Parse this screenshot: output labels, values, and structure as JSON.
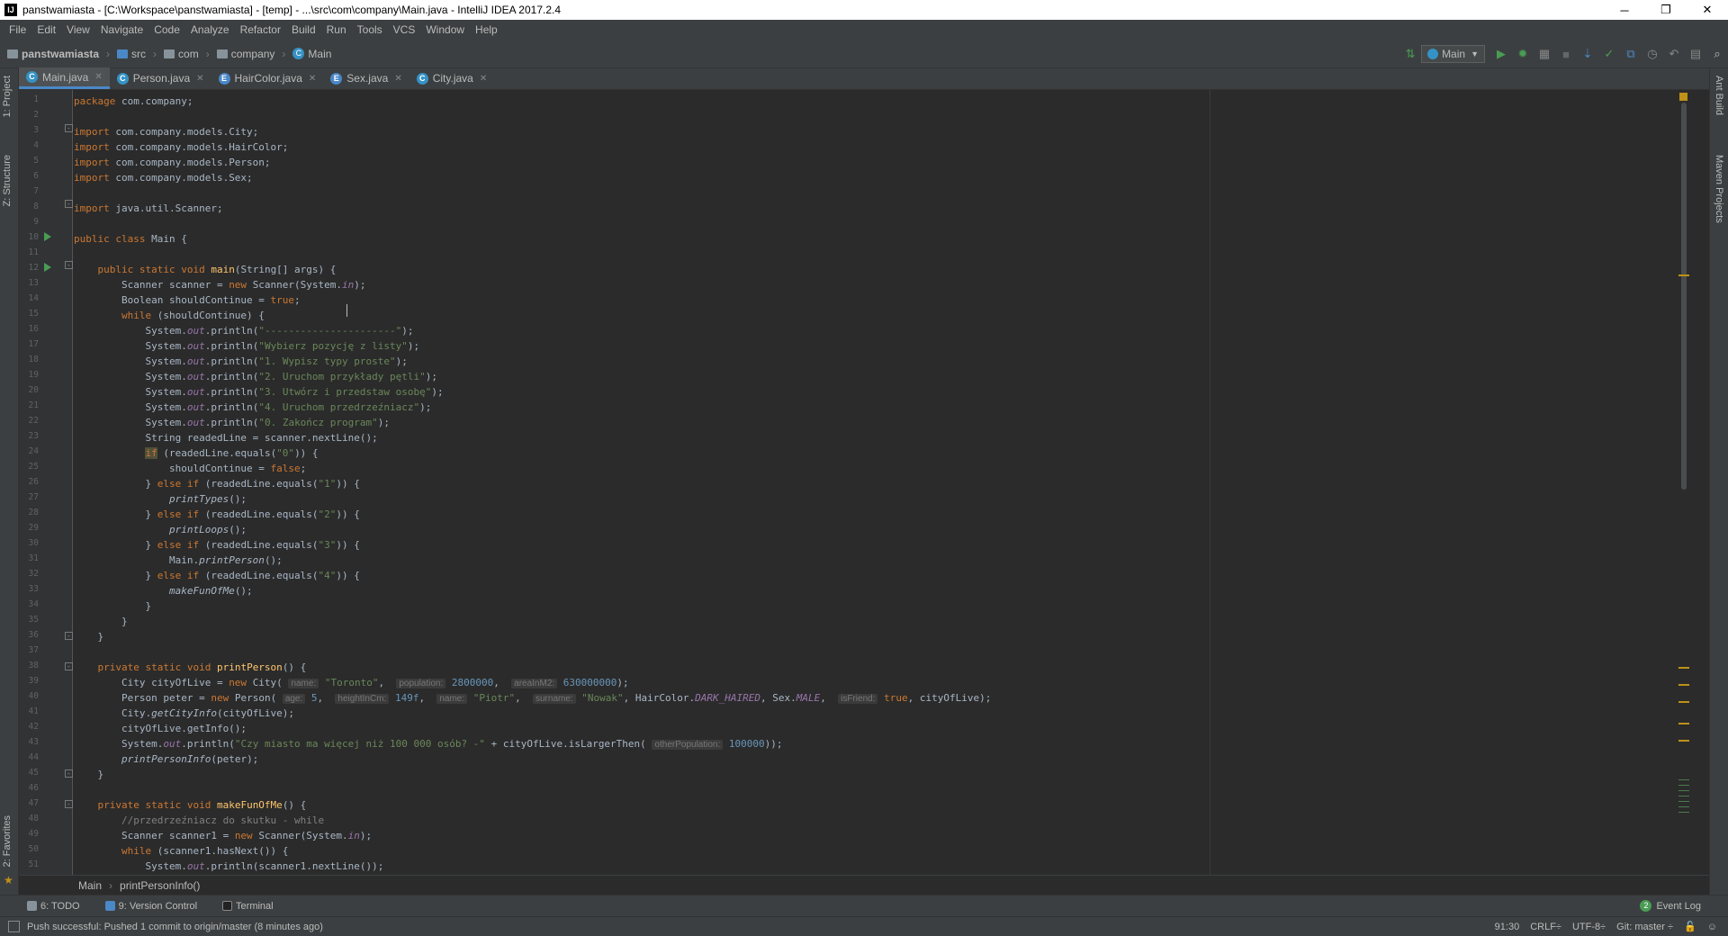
{
  "window": {
    "title": "panstwamiasta - [C:\\Workspace\\panstwamiasta] - [temp] - ...\\src\\com\\company\\Main.java - IntelliJ IDEA 2017.2.4",
    "app_icon": "IJ",
    "minimize": "─",
    "maximize": "❐",
    "close": "✕"
  },
  "menu": [
    "File",
    "Edit",
    "View",
    "Navigate",
    "Code",
    "Analyze",
    "Refactor",
    "Build",
    "Run",
    "Tools",
    "VCS",
    "Window",
    "Help"
  ],
  "breadcrumb": {
    "project": "panstwamiasta",
    "src": "src",
    "com": "com",
    "company": "company",
    "main": "Main"
  },
  "toolbar": {
    "run_config": "Main",
    "run_icon": "▶",
    "debug_icon": "✹",
    "coverage_icon": "▦",
    "stop_icon": "■",
    "search_icon": "⌕"
  },
  "left_tool_tabs": {
    "project": "1: Project",
    "structure": "Z: Structure",
    "favorites": "2: Favorites"
  },
  "right_tool_tabs": {
    "ant": "Ant Build",
    "maven": "Maven Projects"
  },
  "tabs": [
    {
      "label": "Main.java",
      "icon": "C",
      "color": "#3592c4"
    },
    {
      "label": "Person.java",
      "icon": "C",
      "color": "#3592c4"
    },
    {
      "label": "HairColor.java",
      "icon": "E",
      "color": "#4a88c7"
    },
    {
      "label": "Sex.java",
      "icon": "E",
      "color": "#4a88c7"
    },
    {
      "label": "City.java",
      "icon": "C",
      "color": "#3592c4"
    }
  ],
  "code": {
    "s_pkg": "com.company;",
    "s_imp_city": "com.company.models.City;",
    "s_imp_hair": "com.company.models.HairColor;",
    "s_imp_person": "com.company.models.Person;",
    "s_imp_sex": "com.company.models.Sex;",
    "s_imp_scanner": "java.util.Scanner;",
    "s_class": "Main {",
    "s_main": "main",
    "s_main_args": "(String[] args) {",
    "s16": "\"----------------------\"",
    "s17": "\"Wybierz pozycję z listy\"",
    "s18": "\"1. Wypisz typy proste\"",
    "s19": "\"2. Uruchom przykłady pętli\"",
    "s20": "\"3. Utwórz i przedstaw osobę\"",
    "s21": "\"4. Uruchom przedrzeźniacz\"",
    "s22": "\"0. Zakończ program\"",
    "s24": "\"0\"",
    "s26": "\"1\"",
    "s28": "\"2\"",
    "s30": "\"3\"",
    "s32": "\"4\"",
    "s39a": "\"Toronto\"",
    "s39b": "2800000",
    "s39c": "630000000",
    "s40a": "5",
    "s40b": "149f",
    "s40c": "\"Piotr\"",
    "s40d": "\"Nowak\"",
    "s43": "\"Czy miasto ma więcej niż 100 000 osób? -\"",
    "s43n": "100000",
    "s48": "//przedrzeźniacz do skutku - while",
    "h_name": "name:",
    "h_population": "population:",
    "h_area": "areaInM2:",
    "h_age": "age:",
    "h_height": "heightInCm:",
    "h_surname": "surname:",
    "h_isfriend": "isFriend:",
    "h_other": "otherPopulation:"
  },
  "editor_breadcrumb": {
    "cls": "Main",
    "method": "printPersonInfo()"
  },
  "tool_windows": [
    {
      "label": "6: TODO"
    },
    {
      "label": "9: Version Control"
    },
    {
      "label": "Terminal"
    }
  ],
  "event_log": {
    "label": "Event Log",
    "count": "2"
  },
  "status": {
    "message": "Push successful: Pushed 1 commit to origin/master (8 minutes ago)",
    "position": "91:30",
    "line_sep": "CRLF÷",
    "encoding": "UTF-8÷",
    "git": "Git: master ÷"
  }
}
